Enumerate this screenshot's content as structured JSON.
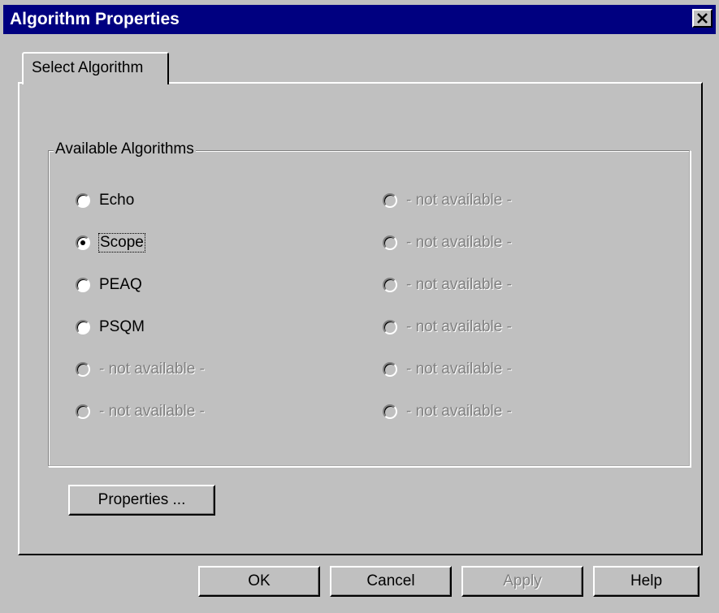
{
  "window": {
    "title": "Algorithm Properties",
    "close_glyph": "✕"
  },
  "tabs": [
    {
      "label": "Select Algorithm",
      "selected": true
    }
  ],
  "group": {
    "title": "Available Algorithms",
    "left_column": [
      {
        "label": "Echo",
        "checked": false,
        "enabled": true
      },
      {
        "label": "Scope",
        "checked": true,
        "enabled": true
      },
      {
        "label": "PEAQ",
        "checked": false,
        "enabled": true
      },
      {
        "label": "PSQM",
        "checked": false,
        "enabled": true
      },
      {
        "label": "- not available -",
        "checked": false,
        "enabled": false
      },
      {
        "label": "- not available -",
        "checked": false,
        "enabled": false
      }
    ],
    "right_column": [
      {
        "label": "- not available -",
        "checked": false,
        "enabled": false
      },
      {
        "label": "- not available -",
        "checked": false,
        "enabled": false
      },
      {
        "label": "- not available -",
        "checked": false,
        "enabled": false
      },
      {
        "label": "- not available -",
        "checked": false,
        "enabled": false
      },
      {
        "label": "- not available -",
        "checked": false,
        "enabled": false
      },
      {
        "label": "- not available -",
        "checked": false,
        "enabled": false
      }
    ]
  },
  "properties_button": "Properties ...",
  "buttons": {
    "ok": "OK",
    "cancel": "Cancel",
    "apply": "Apply",
    "help": "Help"
  },
  "colors": {
    "titlebar": "#000080",
    "face": "#c0c0c0",
    "disabled_text": "#808080"
  }
}
